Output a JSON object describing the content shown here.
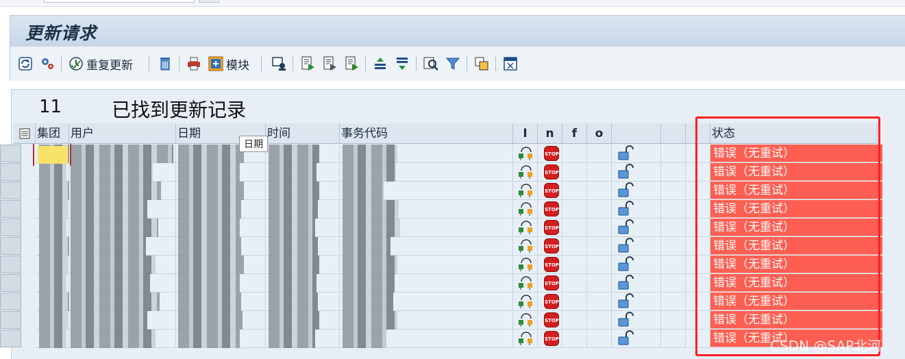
{
  "window": {
    "title": "更新请求"
  },
  "toolbar": {
    "reupdate_label": "重复更新",
    "module_label": "模块"
  },
  "summary": {
    "count": "11",
    "found_text": "已找到更新记录"
  },
  "grid": {
    "columns": {
      "client": "集团",
      "user": "用户",
      "date": "日期",
      "time": "时间",
      "transaction": "事务代码",
      "col_i": "I",
      "col_n": "n",
      "col_f": "f",
      "col_o": "o",
      "status": "状态"
    },
    "tooltip": "日期",
    "rows": [
      {
        "status": "错误（无重试）"
      },
      {
        "status": "错误（无重试）"
      },
      {
        "status": "错误（无重试）"
      },
      {
        "status": "错误（无重试）"
      },
      {
        "status": "错误（无重试）"
      },
      {
        "status": "错误（无重试）"
      },
      {
        "status": "错误（无重试）"
      },
      {
        "status": "错误（无重试）"
      },
      {
        "status": "错误（无重试）"
      },
      {
        "status": "错误（无重试）"
      },
      {
        "status": "错误（无重试）"
      }
    ],
    "stop_text": "STOP"
  },
  "watermark": "CSDN @SAP北河",
  "colors": {
    "status_error": "#ff5f52",
    "highlight_frame": "#ff1f1f",
    "title_bar": "#c6d7e8"
  }
}
